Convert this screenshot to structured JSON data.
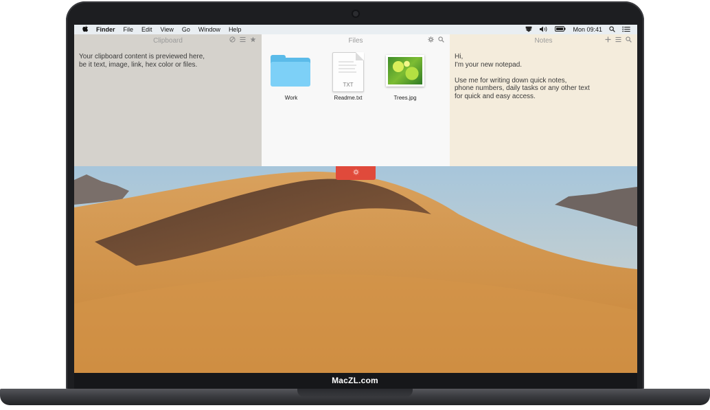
{
  "menubar": {
    "apple": "",
    "items": [
      "Finder",
      "File",
      "Edit",
      "View",
      "Go",
      "Window",
      "Help"
    ],
    "clock": "Mon 09:41"
  },
  "clipboard": {
    "title": "Clipboard",
    "text": "Your clipboard content is previewed here, be it text, image, link, hex color or files.",
    "lines": [
      "Your clipboard content is previewed here,",
      "be it text, image, link, hex color or files."
    ]
  },
  "files": {
    "title": "Files",
    "items": [
      {
        "name": "Work",
        "icon": "folder-icon"
      },
      {
        "name": "Readme.txt",
        "icon": "text-file-icon",
        "ext": "TXT"
      },
      {
        "name": "Trees.jpg",
        "icon": "image-file-icon"
      }
    ]
  },
  "notes": {
    "title": "Notes",
    "lines": [
      "Hi,",
      "I'm your new notepad.",
      "",
      "Use me for writing down quick notes,",
      "phone numbers, daily tasks or any other text",
      "for quick and easy access."
    ]
  },
  "colors": {
    "accent_tab": "#e04a3b",
    "folder": "#5bbbe9",
    "clipboard_bg": "#d5d2cc",
    "notes_bg": "#f4ecdc"
  },
  "brand": "MacZL.com"
}
